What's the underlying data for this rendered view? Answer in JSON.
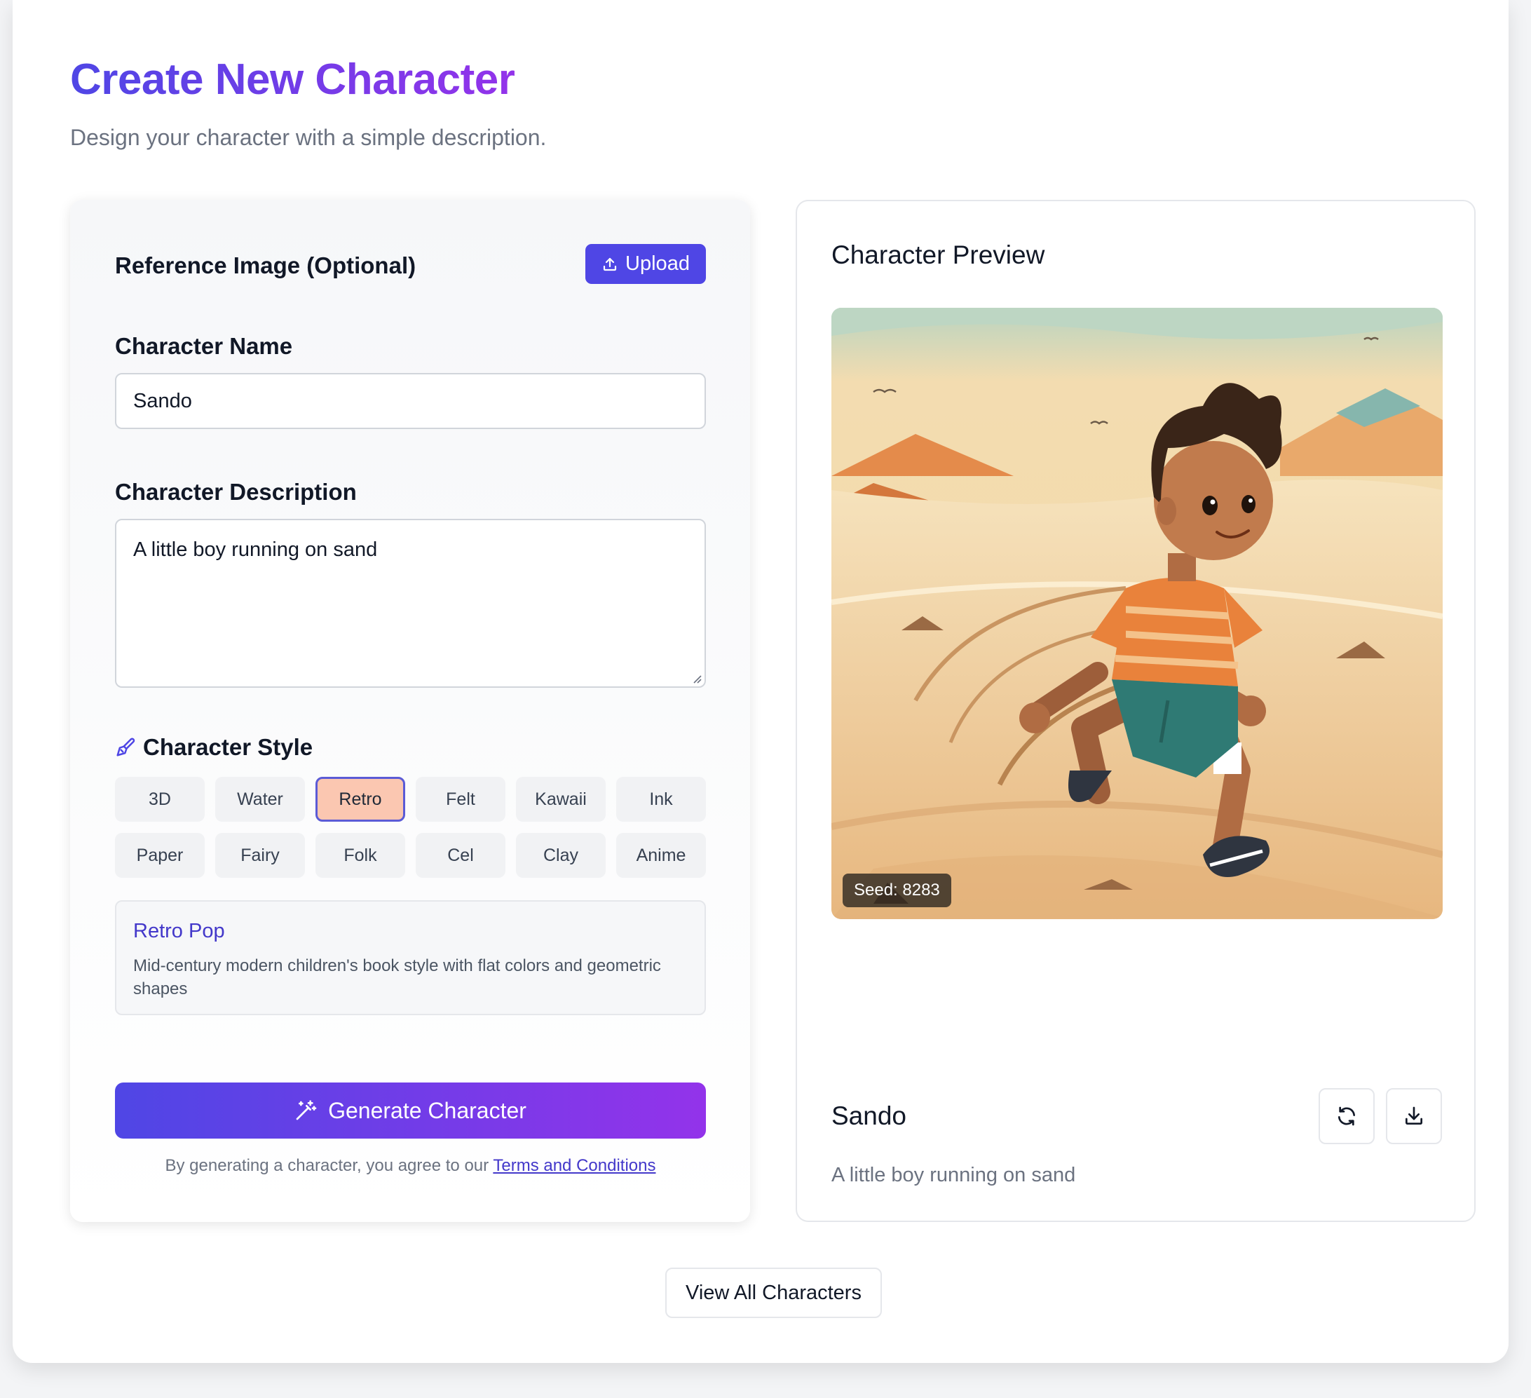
{
  "page": {
    "title": "Create New Character",
    "subtitle": "Design your character with a simple description."
  },
  "form": {
    "reference_label": "Reference Image (Optional)",
    "upload_label": "Upload",
    "name_label": "Character Name",
    "name_value": "Sando",
    "description_label": "Character Description",
    "description_value": "A little boy running on sand",
    "style_label": "Character Style",
    "styles": [
      "3D",
      "Water",
      "Retro",
      "Felt",
      "Kawaii",
      "Ink",
      "Paper",
      "Fairy",
      "Folk",
      "Cel",
      "Clay",
      "Anime"
    ],
    "selected_style": "Retro",
    "style_info": {
      "title": "Retro Pop",
      "description": "Mid-century modern children's book style with flat colors and geometric shapes"
    },
    "generate_label": "Generate Character",
    "terms_prefix": "By generating a character, you agree to our ",
    "terms_link": "Terms and Conditions"
  },
  "preview": {
    "title": "Character Preview",
    "seed": "Seed: 8283",
    "name": "Sando",
    "description": "A little boy running on sand",
    "icons": [
      "refresh-icon",
      "download-icon"
    ]
  },
  "footer": {
    "view_all_label": "View All Characters"
  },
  "colors": {
    "primary": "#4f46e5",
    "accent": "#9333ea",
    "selected_chip": "#fbc7b1"
  }
}
